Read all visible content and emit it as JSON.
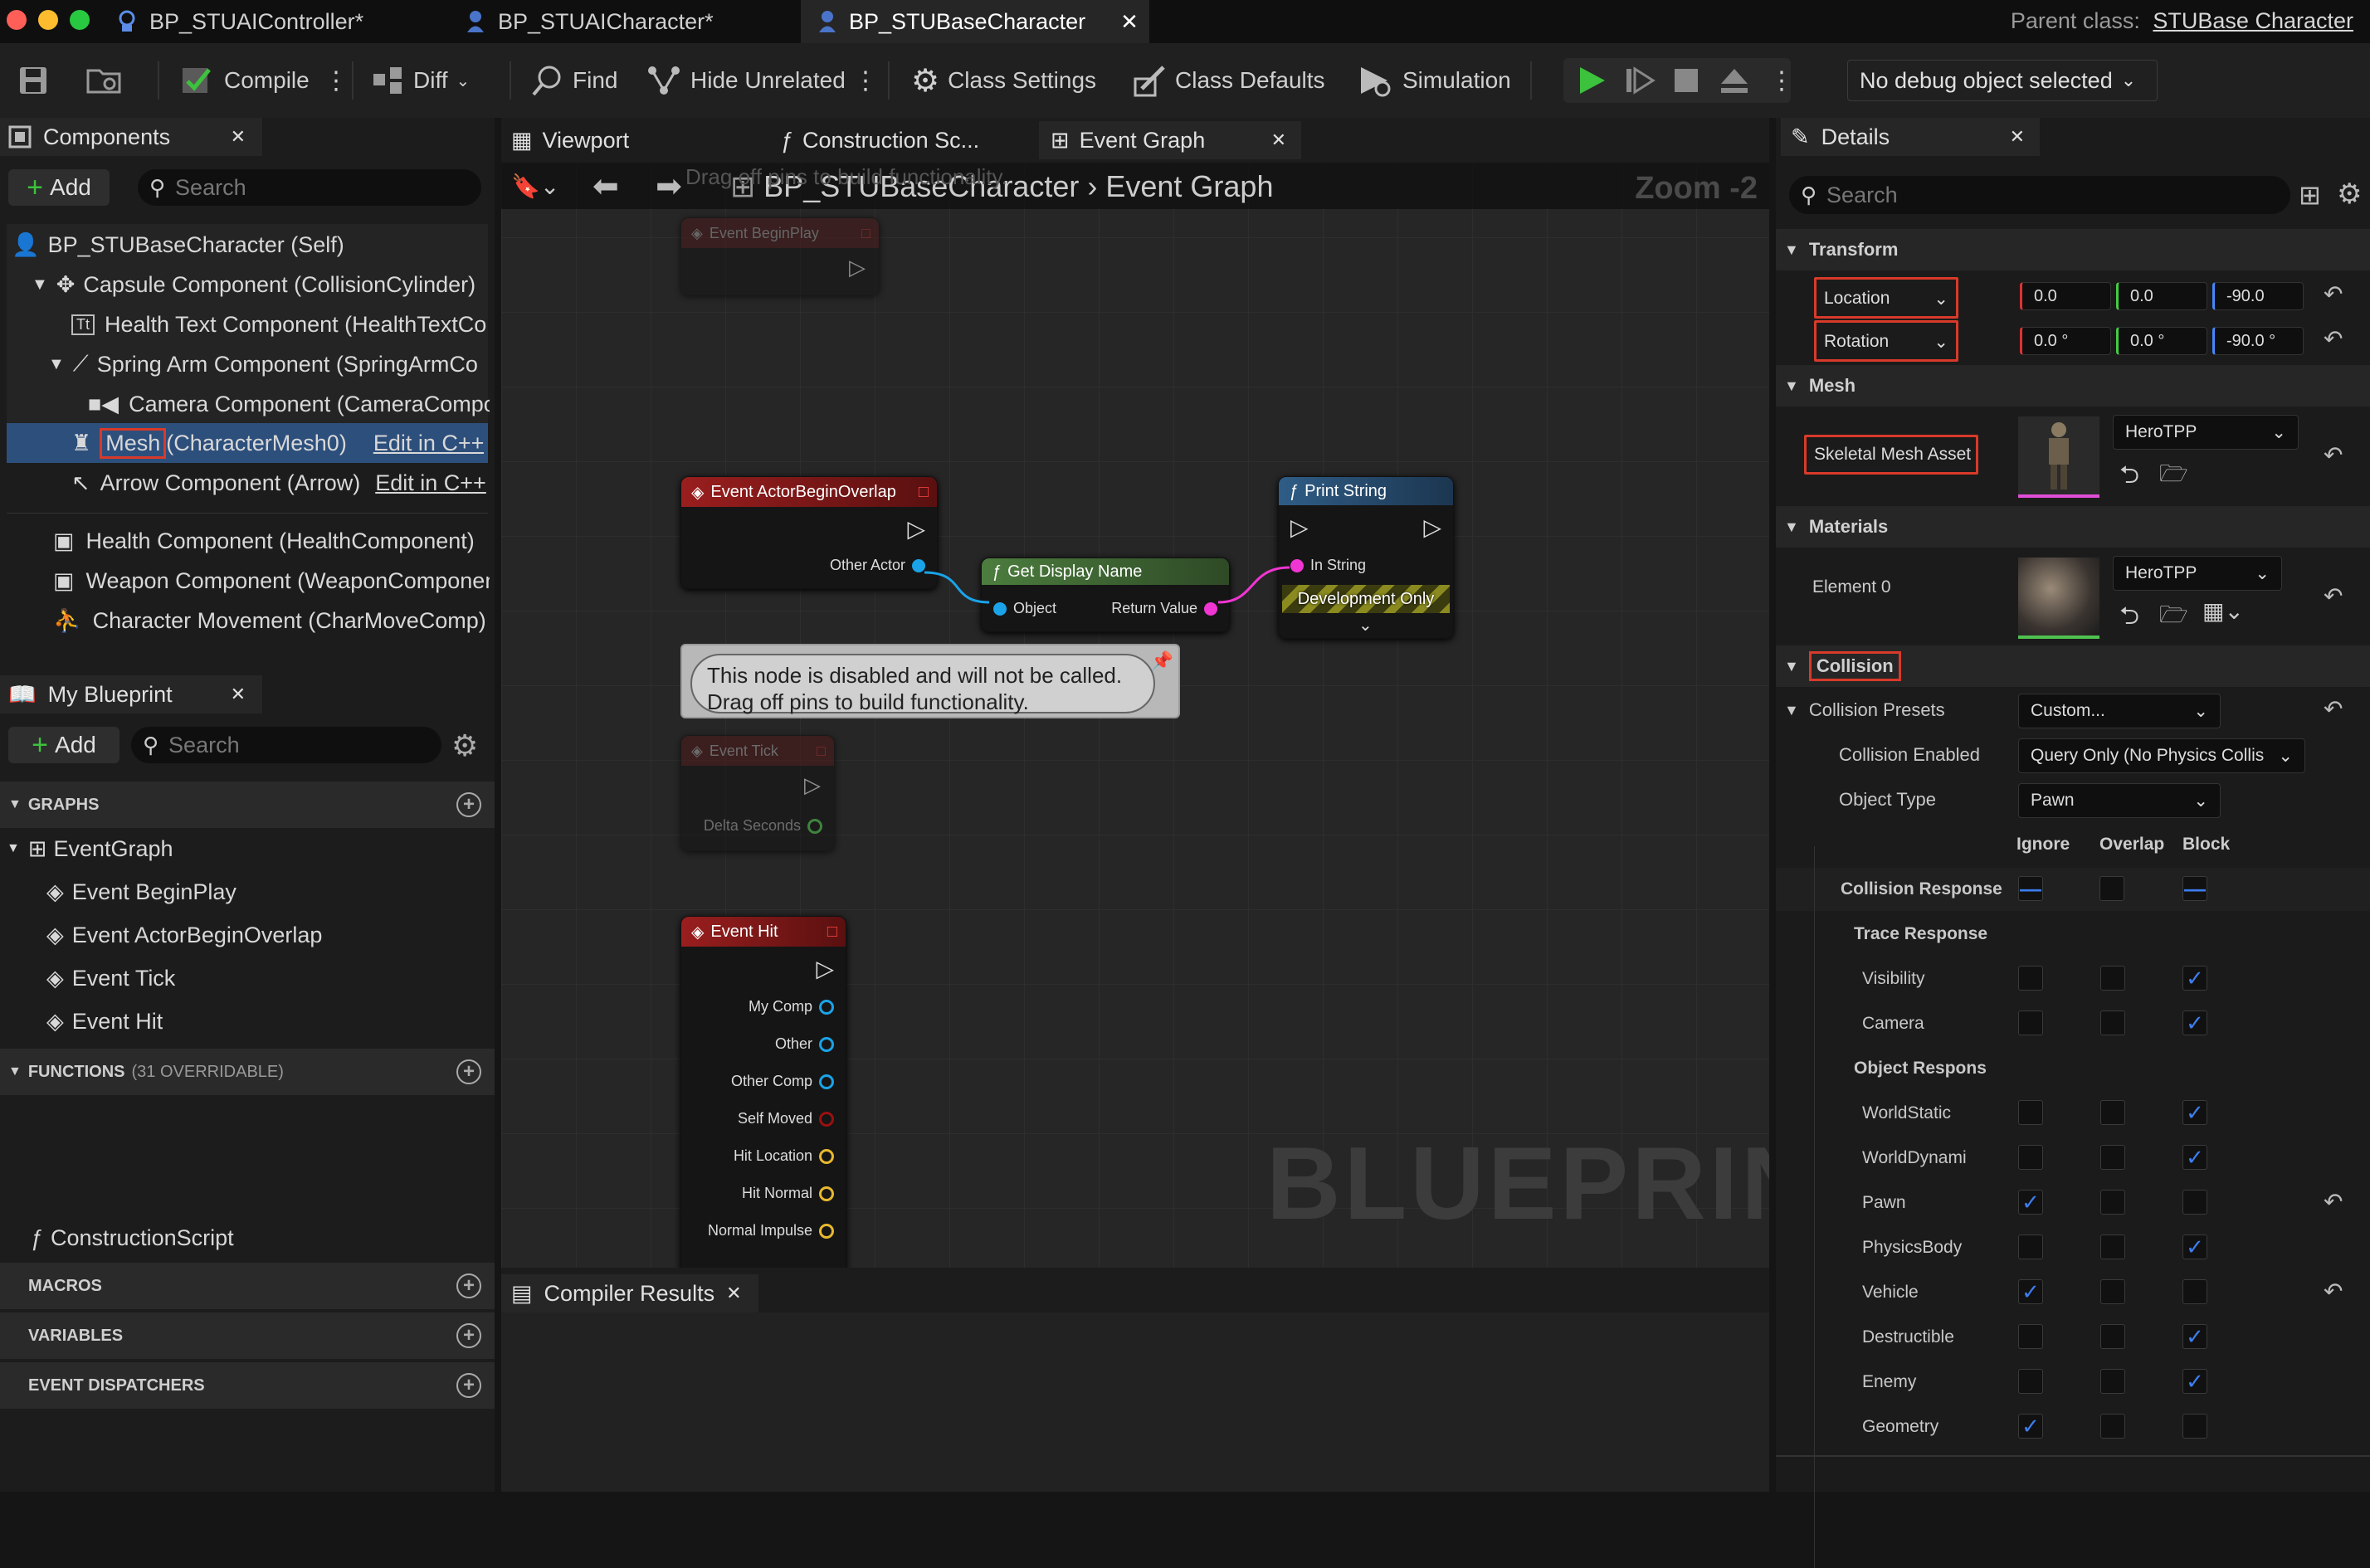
{
  "tabs": [
    {
      "label": "BP_STUAIController*",
      "icon": "blueprint-icon"
    },
    {
      "label": "BP_STUAICharacter*",
      "icon": "character-icon"
    },
    {
      "label": "BP_STUBaseCharacter",
      "icon": "character-icon"
    }
  ],
  "parent_class": {
    "label": "Parent class:",
    "value": "STUBase Character"
  },
  "toolbar": {
    "compile": "Compile",
    "diff": "Diff",
    "find": "Find",
    "hide_unrelated": "Hide Unrelated",
    "class_settings": "Class Settings",
    "class_defaults": "Class Defaults",
    "simulation": "Simulation",
    "debug_object": "No debug object selected"
  },
  "components": {
    "title": "Components",
    "add": "Add",
    "search_placeholder": "Search",
    "items": [
      "BP_STUBaseCharacter (Self)",
      "Capsule Component (CollisionCylinder)",
      "Health Text Component (HealthTextCo",
      "Spring Arm Component (SpringArmCo",
      "Camera Component (CameraCompo",
      "Mesh",
      "(CharacterMesh0)",
      "Edit in C++",
      "Arrow Component (Arrow)",
      "Edit in C++",
      "Health Component (HealthComponent)",
      "Weapon Component (WeaponComponen",
      "Character Movement (CharMoveComp)"
    ]
  },
  "my_blueprint": {
    "title": "My Blueprint",
    "add": "Add",
    "search_placeholder": "Search",
    "graphs_label": "GRAPHS",
    "event_graph": "EventGraph",
    "events": [
      "Event BeginPlay",
      "Event ActorBeginOverlap",
      "Event Tick",
      "Event Hit"
    ],
    "functions_label": "FUNCTIONS",
    "functions_note": "(31 OVERRIDABLE)",
    "construction_script": "ConstructionScript",
    "macros": "MACROS",
    "variables": "VARIABLES",
    "event_dispatchers": "EVENT DISPATCHERS"
  },
  "editor_tabs": [
    "Viewport",
    "Construction Sc...",
    "Event Graph"
  ],
  "graph": {
    "breadcrumb_root": "BP_STUBaseCharacter",
    "breadcrumb_leaf": "Event Graph",
    "zoom": "Zoom -2",
    "watermark": "BLUEPRINT",
    "top_comment": "Drag off pins to build functionality.",
    "comment_line1": "This node is disabled and will not be called.",
    "comment_line2": "Drag off pins to build functionality.",
    "nodes": {
      "begin_play": "Event BeginPlay",
      "actor_overlap": "Event ActorBeginOverlap",
      "other_actor": "Other Actor",
      "get_display_name": "Get Display Name",
      "object": "Object",
      "return_value": "Return Value",
      "print_string": "Print String",
      "in_string": "In String",
      "dev_only": "Development Only",
      "event_tick": "Event Tick",
      "delta_seconds": "Delta Seconds",
      "event_hit": "Event Hit",
      "hit_pins": [
        "My Comp",
        "Other",
        "Other Comp",
        "Self Moved",
        "Hit Location",
        "Hit Normal",
        "Normal Impulse"
      ]
    }
  },
  "compiler_results": "Compiler Results",
  "details": {
    "title": "Details",
    "search_placeholder": "Search",
    "transform": "Transform",
    "location": {
      "label": "Location",
      "x": "0.0",
      "y": "0.0",
      "z": "-90.0"
    },
    "rotation": {
      "label": "Rotation",
      "x": "0.0 °",
      "y": "0.0 °",
      "z": "-90.0 °"
    },
    "mesh": "Mesh",
    "skeletal_mesh_asset": "Skeletal Mesh Asset",
    "mesh_value": "HeroTPP",
    "materials": "Materials",
    "element0": "Element 0",
    "material_value": "HeroTPP",
    "collision": "Collision",
    "collision_presets": {
      "label": "Collision Presets",
      "value": "Custom..."
    },
    "collision_enabled": {
      "label": "Collision Enabled",
      "value": "Query Only (No Physics Collis"
    },
    "object_type": {
      "label": "Object Type",
      "value": "Pawn"
    },
    "col_ignore": "Ignore",
    "col_overlap": "Overlap",
    "col_block": "Block",
    "collision_responses": "Collision Response",
    "trace_responses": "Trace Response",
    "object_responses": "Object Respons",
    "rows": [
      {
        "label": "Visibility",
        "state": "block"
      },
      {
        "label": "Camera",
        "state": "block"
      },
      {
        "label": "WorldStatic",
        "state": "block"
      },
      {
        "label": "WorldDynami",
        "state": "block"
      },
      {
        "label": "Pawn",
        "state": "ignore"
      },
      {
        "label": "PhysicsBody",
        "state": "block"
      },
      {
        "label": "Vehicle",
        "state": "ignore"
      },
      {
        "label": "Destructible",
        "state": "block"
      },
      {
        "label": "Enemy",
        "state": "block"
      },
      {
        "label": "Geometry",
        "state": "ignore"
      }
    ]
  },
  "colors": {
    "accent": "#3d7ef0",
    "highlight": "#d83a2a",
    "event_red": "#8b1a1a",
    "function_blue": "#2f5d86",
    "pure_green": "#3f6a36",
    "play_green": "#3cc23c"
  }
}
